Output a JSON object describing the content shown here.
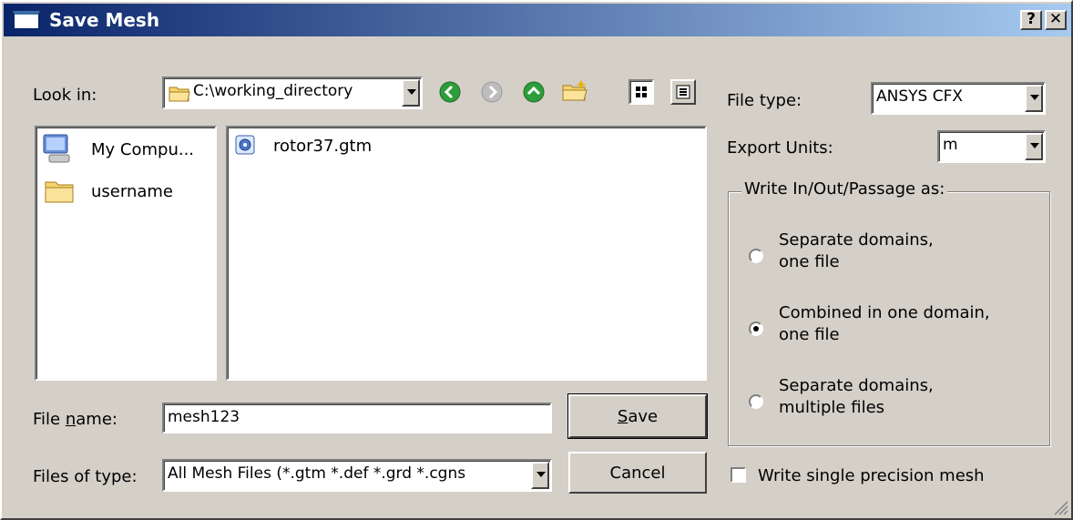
{
  "window": {
    "title": "Save Mesh",
    "help_btn": "?",
    "close_btn": "✕"
  },
  "look_in": {
    "label": "Look in:",
    "value": "C:\\working_directory"
  },
  "places": [
    {
      "label": "My Compu...",
      "icon": "computer-icon"
    },
    {
      "label": "username",
      "icon": "folder-icon"
    }
  ],
  "files": [
    {
      "name": "rotor37.gtm",
      "icon": "file-icon"
    }
  ],
  "filename": {
    "label_pre": "File ",
    "label_u": "n",
    "label_post": "ame:",
    "value": "mesh123"
  },
  "files_of_type": {
    "label": "Files of type:",
    "value": "All Mesh Files (*.gtm *.def *.grd *.cgns"
  },
  "buttons": {
    "save_u": "S",
    "save_rest": "ave",
    "cancel": "Cancel"
  },
  "file_type": {
    "label": "File type:",
    "value": "ANSYS CFX"
  },
  "export_units": {
    "label": "Export Units:",
    "value": "m"
  },
  "write_group": {
    "title": "Write In/Out/Passage as:",
    "options": [
      {
        "line1": "Separate domains,",
        "line2": "one file",
        "selected": false
      },
      {
        "line1": "Combined in one domain,",
        "line2": "one file",
        "selected": true
      },
      {
        "line1": "Separate domains,",
        "line2": "multiple files",
        "selected": false
      }
    ]
  },
  "single_precision": {
    "label": "Write single precision mesh",
    "checked": false
  }
}
